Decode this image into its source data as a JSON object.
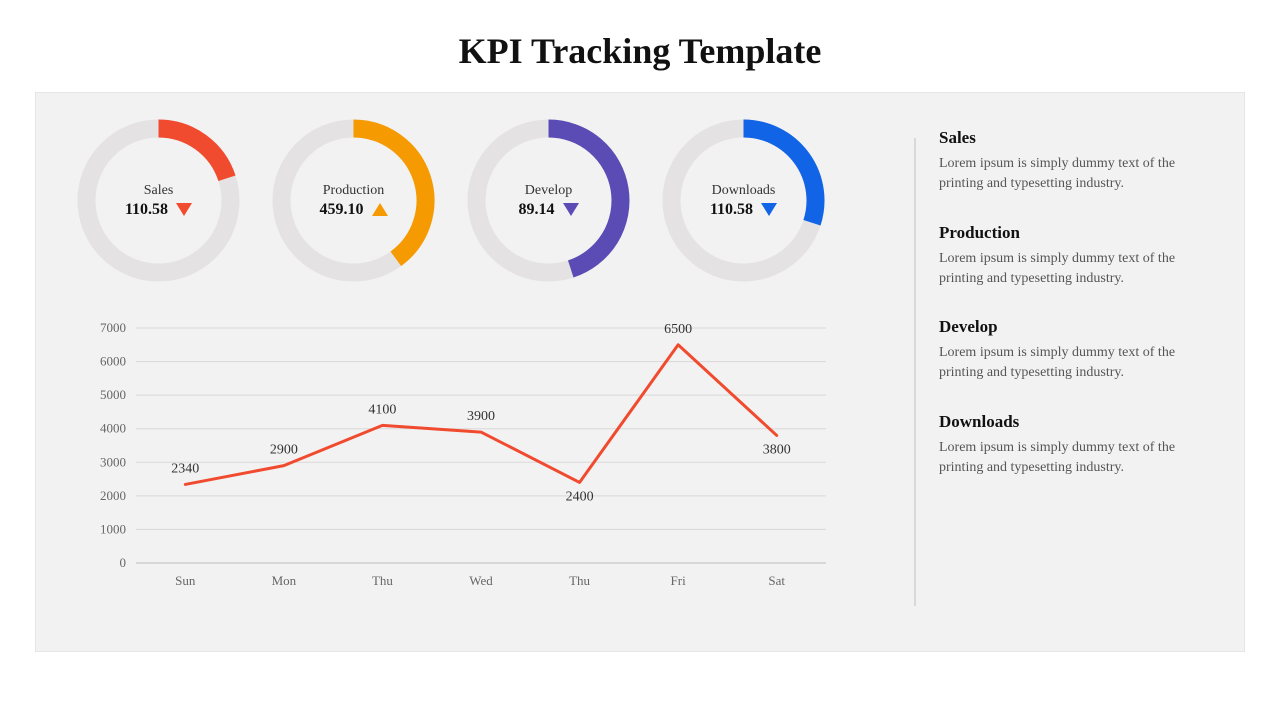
{
  "title": "KPI Tracking Template",
  "gauges": [
    {
      "label": "Sales",
      "value": "110.58",
      "fraction": 0.2,
      "color": "#f04b2f",
      "trend": "down"
    },
    {
      "label": "Production",
      "value": "459.10",
      "fraction": 0.4,
      "color": "#f59a00",
      "trend": "up"
    },
    {
      "label": "Develop",
      "value": "89.14",
      "fraction": 0.45,
      "color": "#5b4cb5",
      "trend": "down"
    },
    {
      "label": "Downloads",
      "value": "110.58",
      "fraction": 0.3,
      "color": "#1264e6",
      "trend": "down"
    }
  ],
  "chart_data": {
    "type": "line",
    "categories": [
      "Sun",
      "Mon",
      "Thu",
      "Wed",
      "Thu",
      "Fri",
      "Sat"
    ],
    "values": [
      2340,
      2900,
      4100,
      3900,
      2400,
      6500,
      3800
    ],
    "title": "",
    "xlabel": "",
    "ylabel": "",
    "ylim": [
      0,
      7000
    ],
    "yticks": [
      0,
      1000,
      2000,
      3000,
      4000,
      5000,
      6000,
      7000
    ],
    "line_color": "#f04b2f"
  },
  "side": [
    {
      "h": "Sales",
      "p": "Lorem ipsum is simply dummy text of the printing and typesetting industry."
    },
    {
      "h": "Production",
      "p": "Lorem ipsum is simply dummy text of the printing and typesetting industry."
    },
    {
      "h": "Develop",
      "p": "Lorem ipsum is simply dummy text of the printing and typesetting industry."
    },
    {
      "h": "Downloads",
      "p": "Lorem ipsum is simply dummy text of the printing and typesetting industry."
    }
  ]
}
